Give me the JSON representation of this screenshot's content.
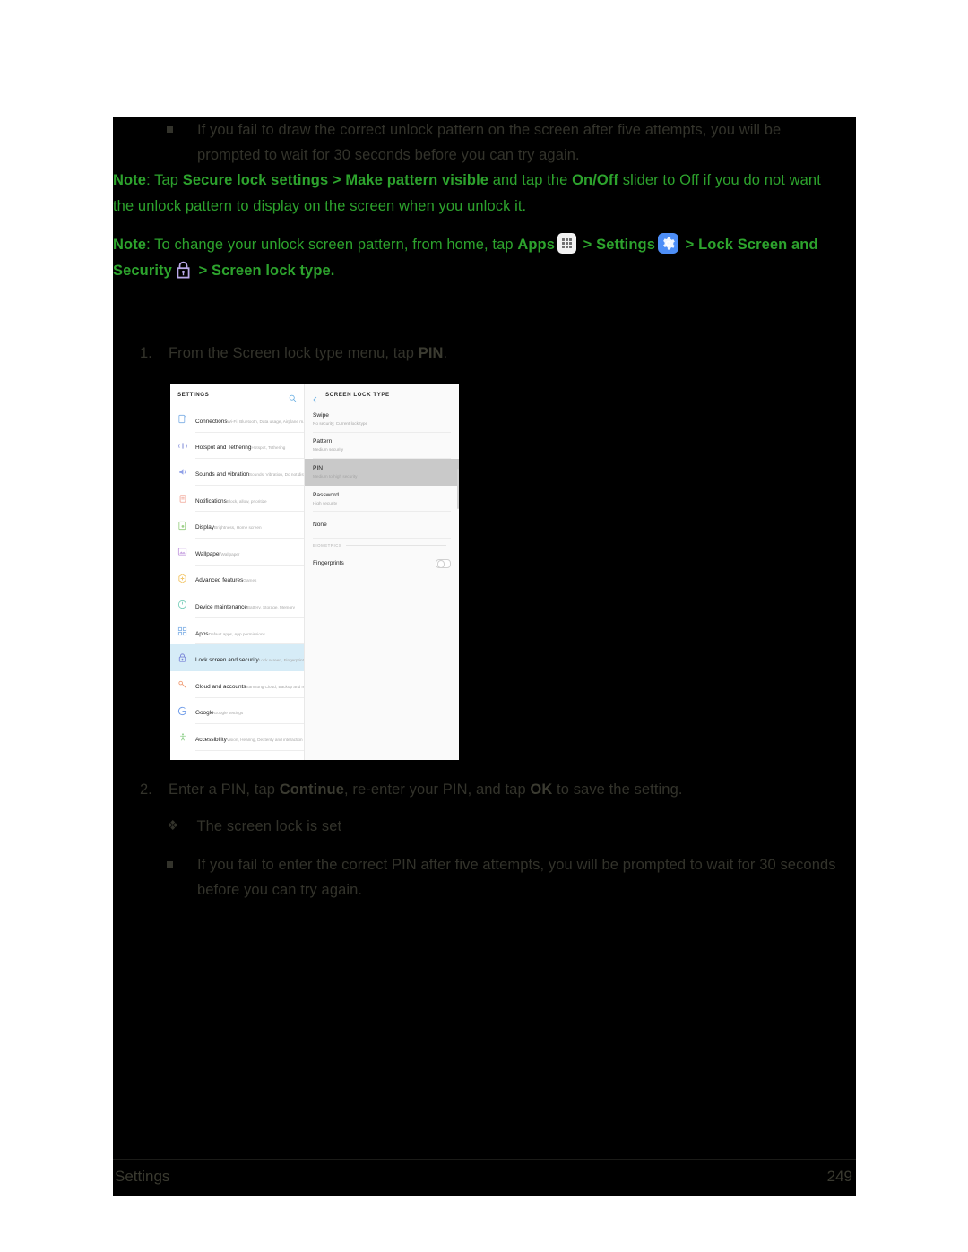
{
  "document": {
    "footer": {
      "section": "Settings",
      "page": "249"
    }
  },
  "body": {
    "bullet_1": "If you fail to draw the correct unlock pattern on the screen after five attempts, you will be prompted to wait for 30 seconds before you can try again.",
    "note_1": {
      "label": "Note",
      "p1": ": Tap ",
      "b1": "Secure lock settings > Make pattern visible",
      "p2": " and tap the ",
      "b2": "On/Off",
      "p3": " slider to Off if you do not want the unlock pattern to display on the screen when you unlock it."
    },
    "note_2": {
      "label": "Note",
      "p1": ": To change your unlock screen pattern, from home, tap ",
      "b1": "Apps",
      "sep1": " > ",
      "b2": "Settings",
      "sep2": " > ",
      "b3": "Lock Screen and Security",
      "sep3": " > ",
      "b4": "Screen lock type",
      "period": "."
    },
    "step_1": {
      "num": "1.",
      "p1": "From the Screen lock type menu, tap ",
      "b1": "PIN",
      "p2": "."
    },
    "step_2": {
      "num": "2.",
      "p1": "Enter a PIN, tap ",
      "b1": "Continue",
      "p2": ", re-enter your PIN, and tap ",
      "b2": "OK",
      "p3": " to save the setting."
    },
    "result_1": "The screen lock is set",
    "bullet_2": "If you fail to enter the correct PIN after five attempts, you will be prompted to wait for 30 seconds before you can try again."
  },
  "screenshot": {
    "left_panel": {
      "title": "SETTINGS",
      "search_icon": "search-icon",
      "items": [
        {
          "title": "Connections",
          "sub": "Wi-Fi, Bluetooth, Data usage, Airplane m...",
          "icon": "connections-icon",
          "color": "#8ab6e8"
        },
        {
          "title": "Hotspot and Tethering",
          "sub": "Hotspot, Tethering",
          "icon": "hotspot-icon",
          "color": "#9aa3e0"
        },
        {
          "title": "Sounds and vibration",
          "sub": "Sounds, Vibration, Do not disturb",
          "icon": "sound-icon",
          "color": "#8fa0e8"
        },
        {
          "title": "Notifications",
          "sub": "Block, allow, prioritize",
          "icon": "notifications-icon",
          "color": "#f0a394"
        },
        {
          "title": "Display",
          "sub": "Brightness, Home screen",
          "icon": "display-icon",
          "color": "#9fd18a"
        },
        {
          "title": "Wallpaper",
          "sub": "Wallpaper",
          "icon": "wallpaper-icon",
          "color": "#c6a0e0"
        },
        {
          "title": "Advanced features",
          "sub": "Games",
          "icon": "advanced-features-icon",
          "color": "#f2c66a"
        },
        {
          "title": "Device maintenance",
          "sub": "Battery, Storage, Memory",
          "icon": "device-maintenance-icon",
          "color": "#7fd0bd"
        },
        {
          "title": "Apps",
          "sub": "Default apps, App permissions",
          "icon": "apps-grid-icon",
          "color": "#8ab6e8"
        },
        {
          "title": "Lock screen and security",
          "sub": "Lock screen, Fingerprints",
          "icon": "lock-icon",
          "color": "#7b86d8",
          "selected": true
        },
        {
          "title": "Cloud and accounts",
          "sub": "Samsung Cloud, Backup and restore",
          "icon": "cloud-accounts-icon",
          "color": "#f0a07a"
        },
        {
          "title": "Google",
          "sub": "Google settings",
          "icon": "google-icon",
          "color": "#6f9ce8"
        },
        {
          "title": "Accessibility",
          "sub": "Vision, Hearing, Dexterity and interaction",
          "icon": "accessibility-icon",
          "color": "#8ed08a"
        }
      ]
    },
    "right_panel": {
      "back_icon": "back-chevron-icon",
      "title": "SCREEN LOCK TYPE",
      "options": [
        {
          "title": "Swipe",
          "sub": "No security, Current lock type"
        },
        {
          "title": "Pattern",
          "sub": "Medium security"
        },
        {
          "title": "PIN",
          "sub": "Medium to high security",
          "highlight": true
        },
        {
          "title": "Password",
          "sub": "High security"
        },
        {
          "title": "None",
          "sub": ""
        }
      ],
      "section_label": "BIOMETRICS",
      "toggle_row": {
        "label": "Fingerprints",
        "state": "off"
      }
    }
  }
}
